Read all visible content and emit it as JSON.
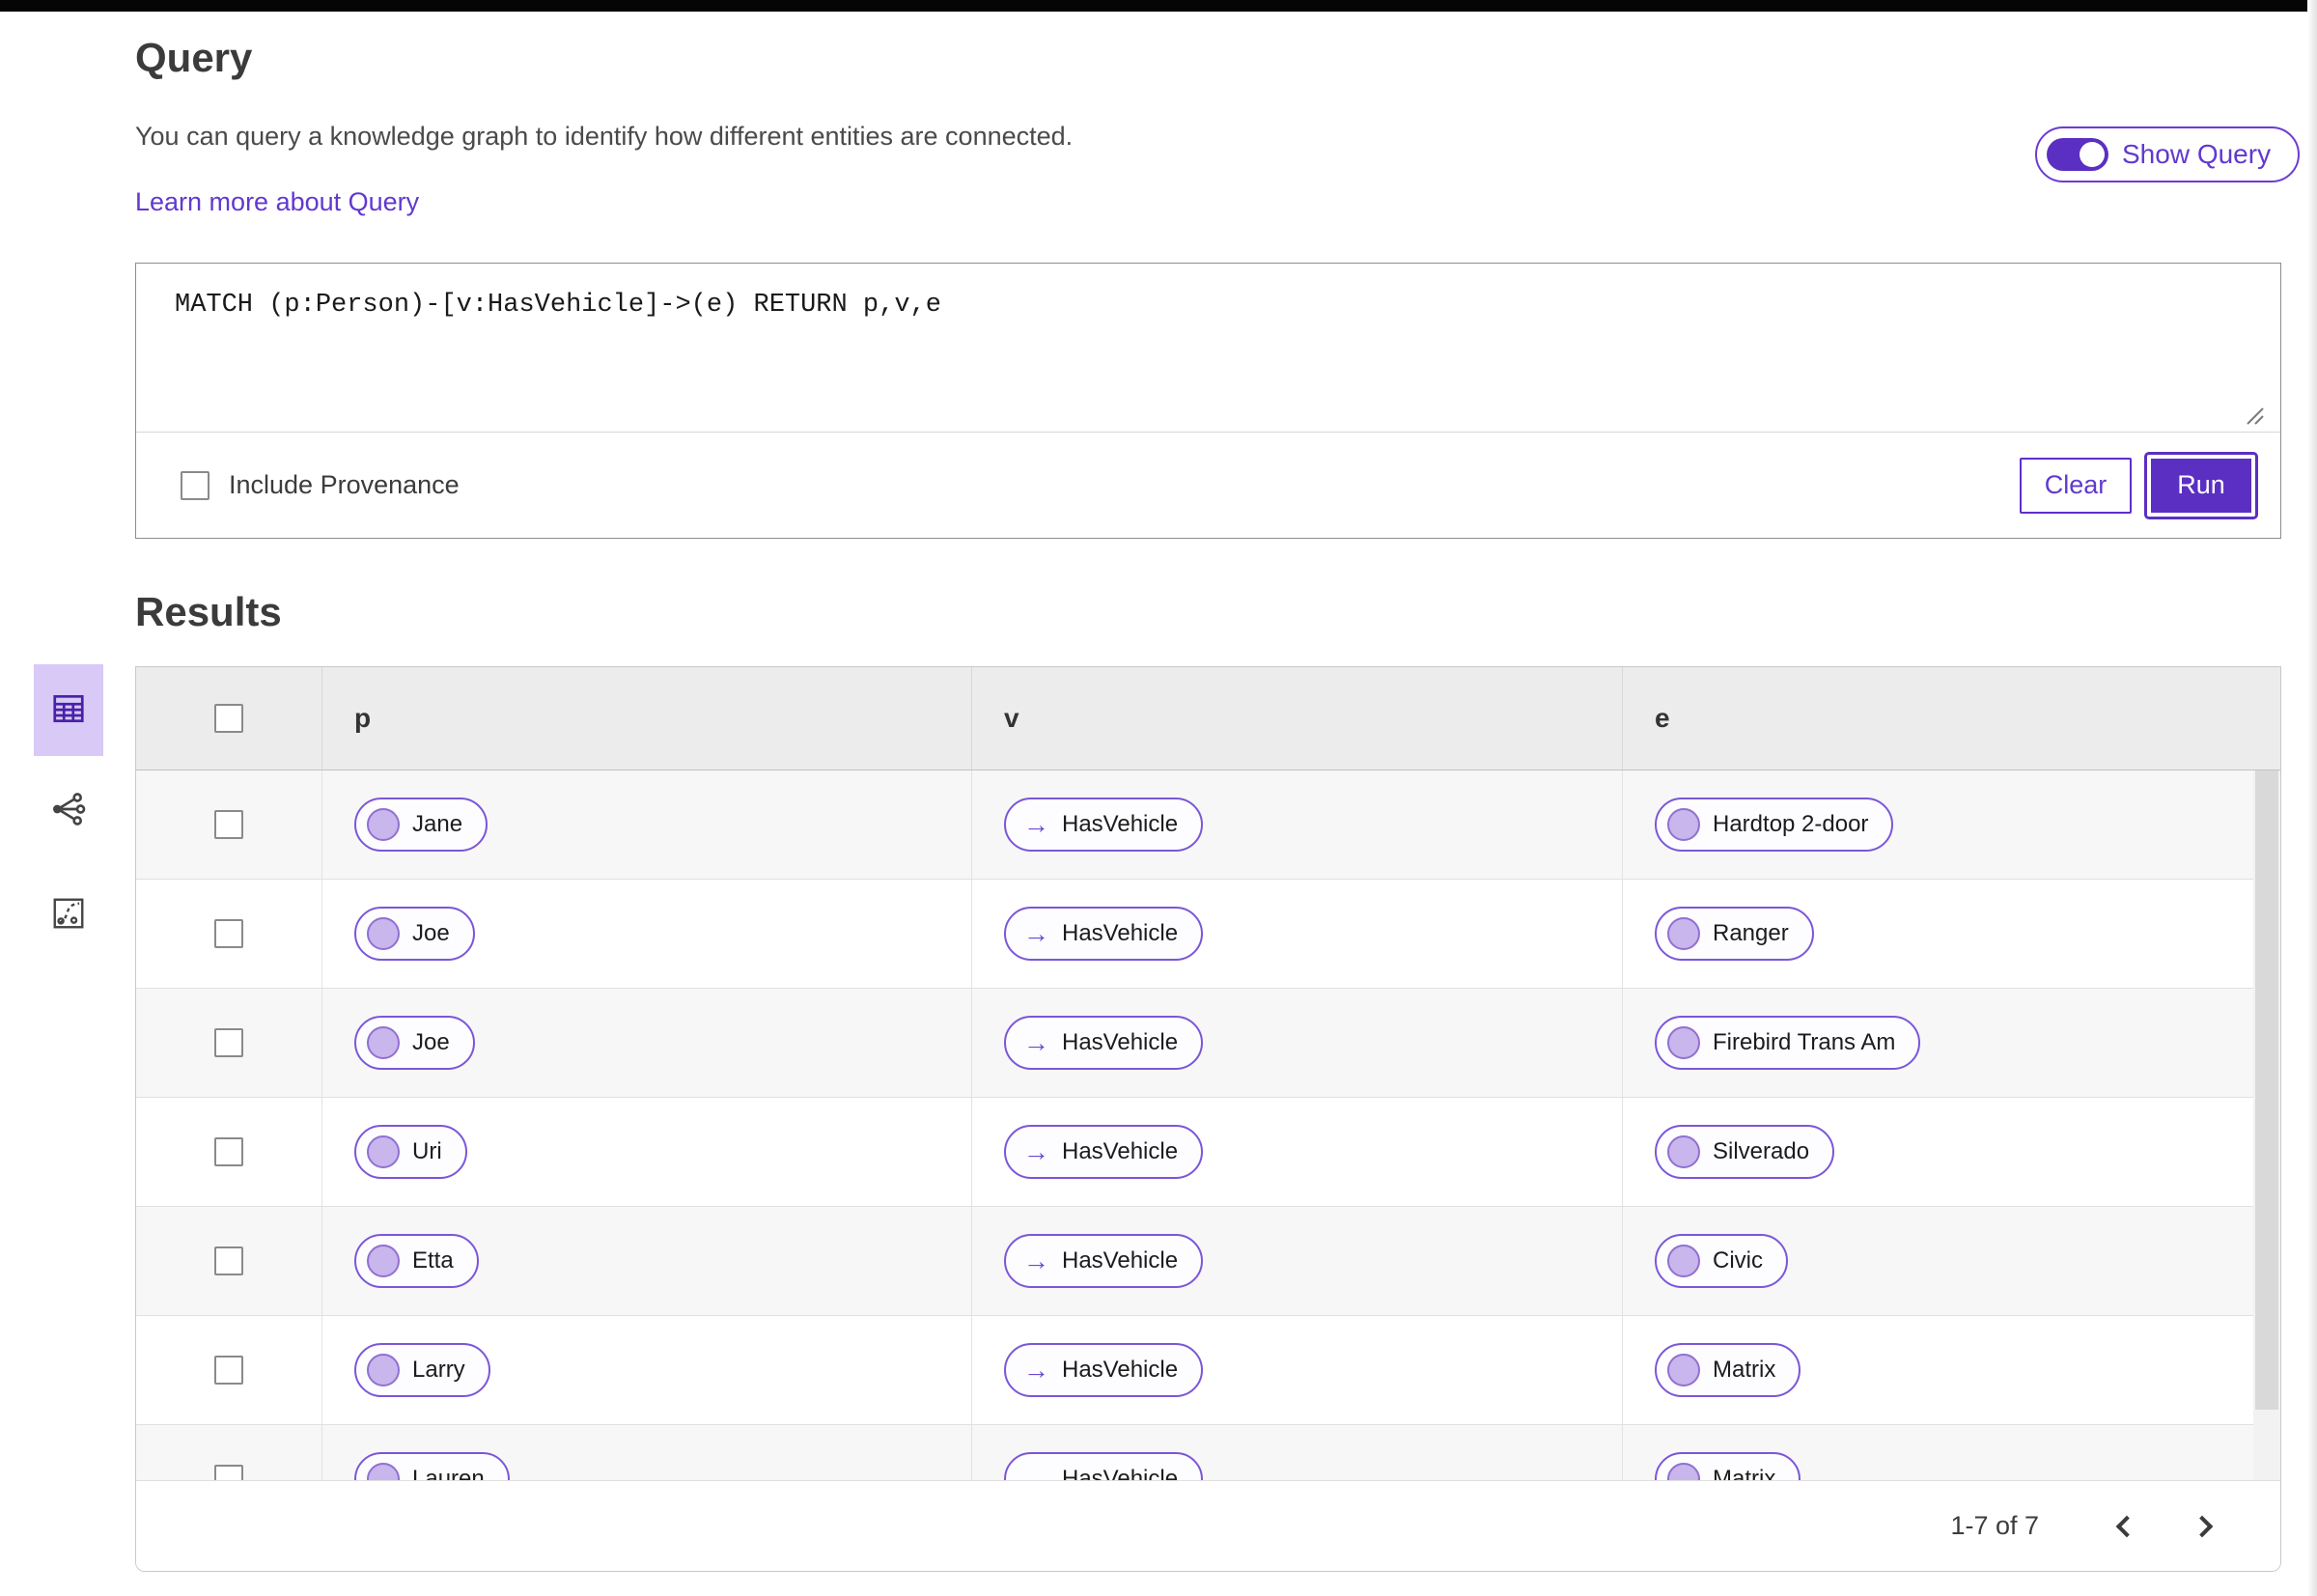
{
  "colors": {
    "accent_purple": "#5b2fc2",
    "link_purple": "#6139cf",
    "pill_border": "#7b57d8",
    "node_circle_fill": "#c8b6ec",
    "table_header_bg": "#ececec",
    "row_stripe": "#f7f7f7",
    "view_tile_active_bg": "#d8c9f7"
  },
  "icons": {
    "edge_arrow": "→"
  },
  "query_section": {
    "title": "Query",
    "description": "You can query a knowledge graph to identify how different entities are connected.",
    "learn_more_label": "Learn more about Query",
    "show_query_toggle": {
      "label": "Show Query",
      "state": "on"
    },
    "query_text": "MATCH (p:Person)-[v:HasVehicle]->(e) RETURN p,v,e",
    "include_provenance": {
      "label": "Include Provenance",
      "checked": false
    },
    "clear_button_label": "Clear",
    "run_button_label": "Run"
  },
  "results_section": {
    "title": "Results",
    "view_switcher": [
      {
        "name": "table-view",
        "icon": "table-icon",
        "active": true
      },
      {
        "name": "graph-view",
        "icon": "network-icon",
        "active": false
      },
      {
        "name": "chart-view",
        "icon": "chart-icon",
        "active": false
      }
    ],
    "table": {
      "columns": [
        "p",
        "v",
        "e"
      ],
      "rows": [
        {
          "p": "Jane",
          "v": "HasVehicle",
          "e": "Hardtop 2-door"
        },
        {
          "p": "Joe",
          "v": "HasVehicle",
          "e": "Ranger"
        },
        {
          "p": "Joe",
          "v": "HasVehicle",
          "e": "Firebird Trans Am"
        },
        {
          "p": "Uri",
          "v": "HasVehicle",
          "e": "Silverado"
        },
        {
          "p": "Etta",
          "v": "HasVehicle",
          "e": "Civic"
        },
        {
          "p": "Larry",
          "v": "HasVehicle",
          "e": "Matrix"
        },
        {
          "p": "Lauren",
          "v": "HasVehicle",
          "e": "Matrix"
        }
      ]
    },
    "pagination": {
      "range_label": "1-7 of 7"
    }
  }
}
